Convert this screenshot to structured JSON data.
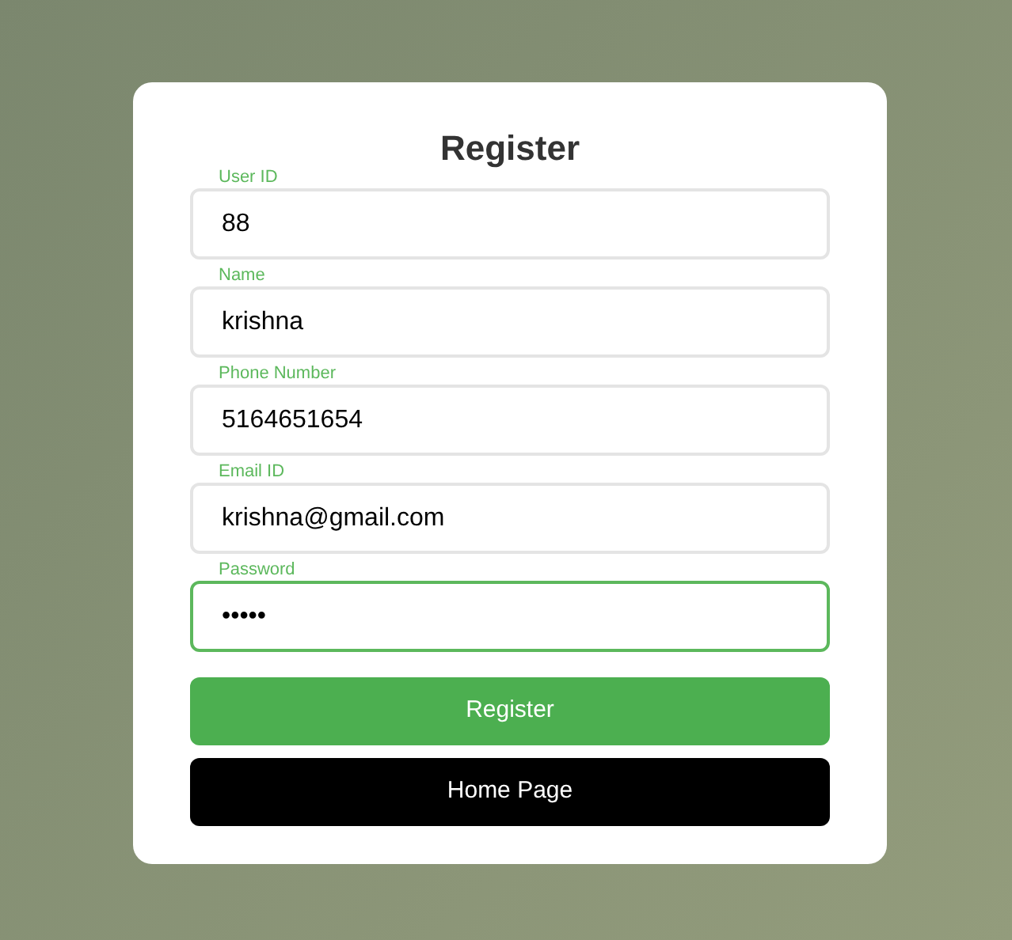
{
  "title": "Register",
  "fields": [
    {
      "label": "User ID",
      "value": "88",
      "focused": false
    },
    {
      "label": "Name",
      "value": "krishna",
      "focused": false
    },
    {
      "label": "Phone Number",
      "value": "5164651654",
      "focused": false
    },
    {
      "label": "Email ID",
      "value": "krishna@gmail.com",
      "focused": false
    },
    {
      "label": "Password",
      "value": "•••••",
      "focused": true
    }
  ],
  "buttons": [
    {
      "label": "Register",
      "kind": "primary"
    },
    {
      "label": "Home Page",
      "kind": "dark"
    }
  ]
}
